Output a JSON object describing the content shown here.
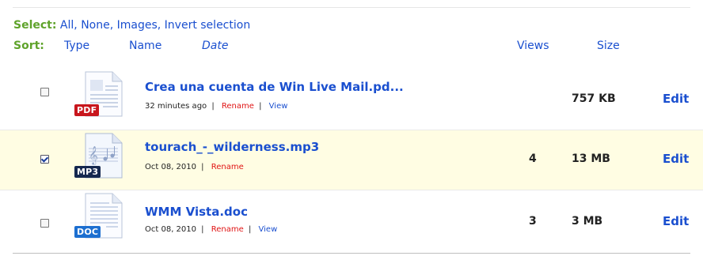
{
  "select_bar": {
    "label": "Select:",
    "options": [
      "All",
      "None",
      "Images",
      "Invert selection"
    ]
  },
  "sort_bar": {
    "label": "Sort:",
    "columns": {
      "type": "Type",
      "name": "Name",
      "date": "Date",
      "views": "Views",
      "size": "Size"
    }
  },
  "files": [
    {
      "name": "Crea una cuenta de Win Live Mail.pd...",
      "type_badge": "PDF",
      "icon": "pdf-file-icon",
      "date": "32 minutes ago",
      "rename_label": "Rename",
      "view_label": "View",
      "views": "",
      "size": "757 KB",
      "edit_label": "Edit",
      "checked": false
    },
    {
      "name": "tourach_-_wilderness.mp3",
      "type_badge": "MP3",
      "icon": "mp3-file-icon",
      "date": "Oct 08, 2010",
      "rename_label": "Rename",
      "view_label": "",
      "views": "4",
      "size": "13 MB",
      "edit_label": "Edit",
      "checked": true
    },
    {
      "name": "WMM Vista.doc",
      "type_badge": "DOC",
      "icon": "doc-file-icon",
      "date": "Oct 08, 2010",
      "rename_label": "Rename",
      "view_label": "View",
      "views": "3",
      "size": "3 MB",
      "edit_label": "Edit",
      "checked": false
    }
  ],
  "colors": {
    "link_blue": "#1a4fcf",
    "label_green": "#5fa32b",
    "rename_red": "#e01414",
    "selected_row_bg": "#fffde3",
    "pdf_badge": "#c8161d",
    "mp3_badge": "#15284f",
    "doc_badge": "#1d6fd0"
  }
}
